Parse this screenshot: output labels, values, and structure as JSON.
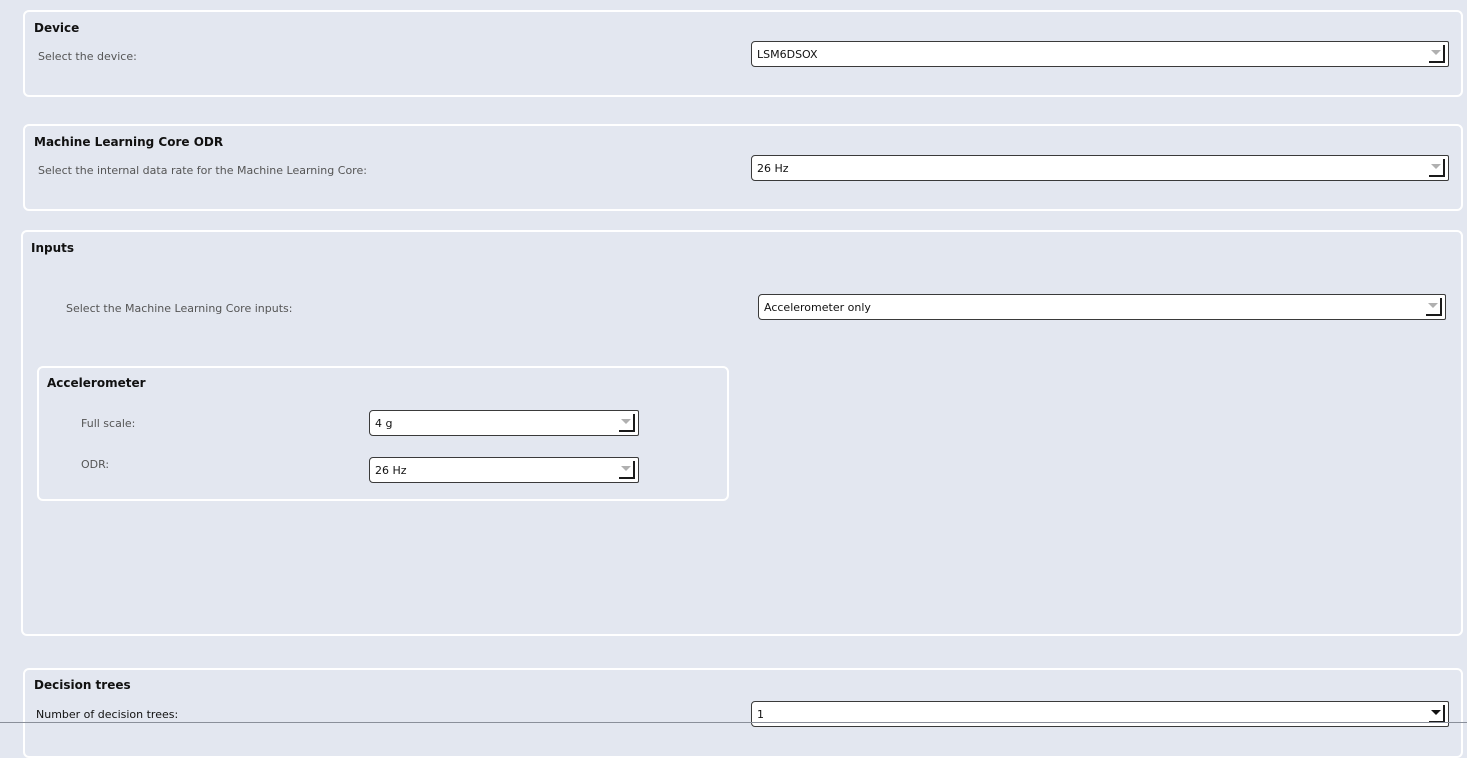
{
  "device_section": {
    "title": "Device",
    "label": "Select the device:",
    "value": "LSM6DSOX"
  },
  "odr_section": {
    "title": "Machine Learning Core ODR",
    "label": "Select the internal data rate for the Machine Learning Core:",
    "value": "26 Hz"
  },
  "inputs_section": {
    "title": "Inputs",
    "label": "Select the Machine Learning Core inputs:",
    "value": "Accelerometer only",
    "accelerometer": {
      "title": "Accelerometer",
      "full_scale_label": "Full scale:",
      "full_scale_value": "4 g",
      "odr_label": "ODR:",
      "odr_value": "26 Hz"
    }
  },
  "decision_trees_section": {
    "title": "Decision trees",
    "label": "Number of decision trees:",
    "value": "1"
  },
  "icons": {
    "dropdown": "chevron-down-icon"
  }
}
